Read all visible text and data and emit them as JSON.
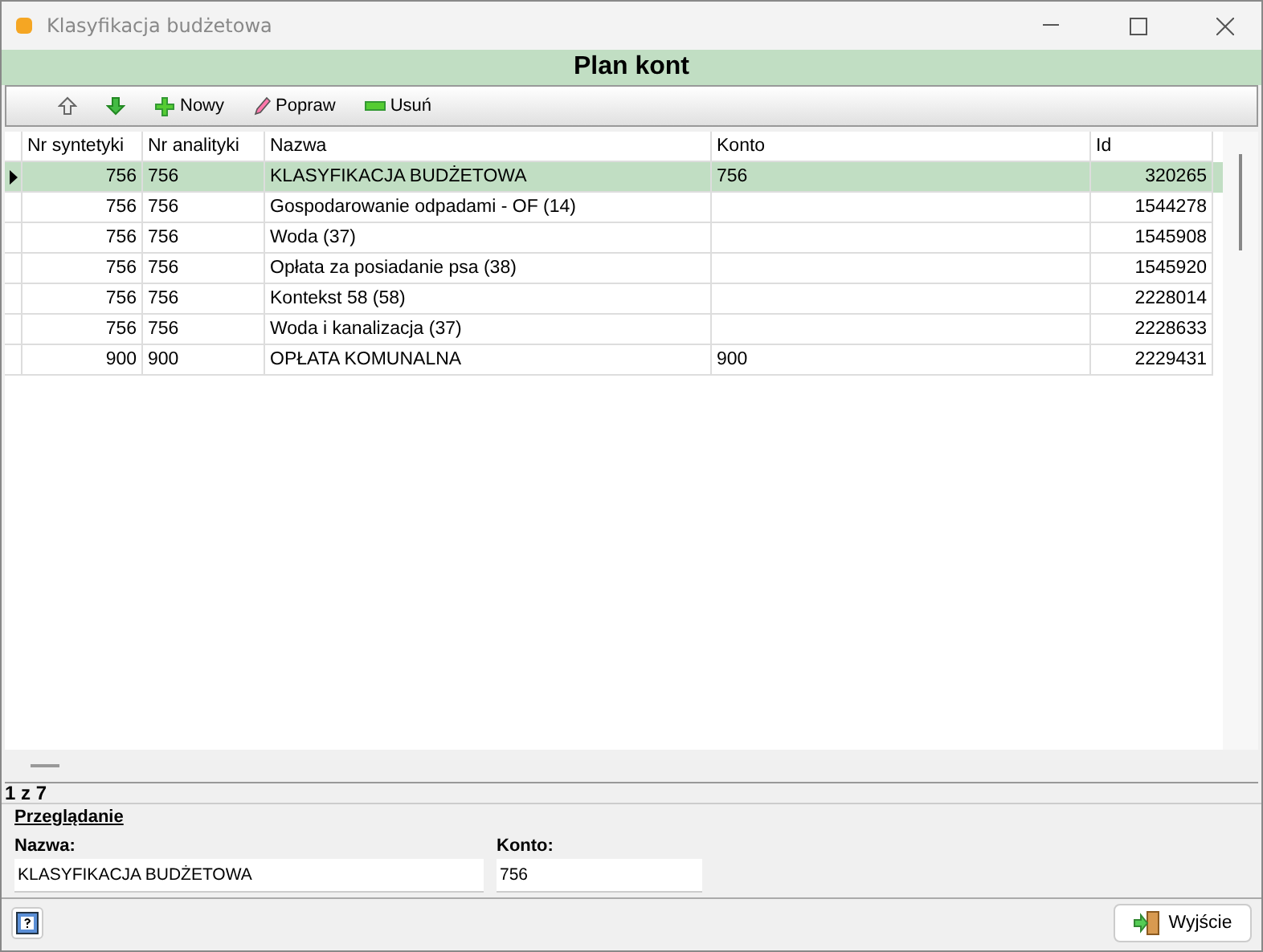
{
  "window": {
    "title": "Klasyfikacja budżetowa"
  },
  "header": "Plan kont",
  "toolbar": [
    {
      "kind": "up"
    },
    {
      "kind": "down"
    },
    {
      "kind": "add",
      "label": "Nowy"
    },
    {
      "kind": "edit",
      "label": "Popraw"
    },
    {
      "kind": "remove",
      "label": "Usuń"
    }
  ],
  "table": {
    "columns": [
      "Nr syntetyki",
      "Nr analityki",
      "Nazwa",
      "Konto",
      "Id"
    ],
    "rows": [
      {
        "selected": true,
        "cells": [
          "756",
          "756",
          "KLASYFIKACJA BUDŻETOWA",
          "756",
          "320265"
        ]
      },
      {
        "selected": false,
        "cells": [
          "756",
          "756",
          "Gospodarowanie odpadami - OF (14)",
          "",
          "1544278"
        ]
      },
      {
        "selected": false,
        "cells": [
          "756",
          "756",
          "Woda (37)",
          "",
          "1545908"
        ]
      },
      {
        "selected": false,
        "cells": [
          "756",
          "756",
          "Opłata za posiadanie psa (38)",
          "",
          "1545920"
        ]
      },
      {
        "selected": false,
        "cells": [
          "756",
          "756",
          "Kontekst 58 (58)",
          "",
          "2228014"
        ]
      },
      {
        "selected": false,
        "cells": [
          "756",
          "756",
          "Woda i kanalizacja (37)",
          "",
          "2228633"
        ]
      },
      {
        "selected": false,
        "cells": [
          "900",
          "900",
          "OPŁATA KOMUNALNA",
          "900",
          "2229431"
        ]
      }
    ]
  },
  "record_counter": "1 z 7",
  "details": {
    "title": "Przeglądanie",
    "fields": [
      {
        "label": "Nazwa:",
        "value": "KLASYFIKACJA BUDŻETOWA"
      },
      {
        "label": "Konto:",
        "value": "756"
      }
    ]
  },
  "footer": {
    "exit_button": "Wyjście"
  }
}
